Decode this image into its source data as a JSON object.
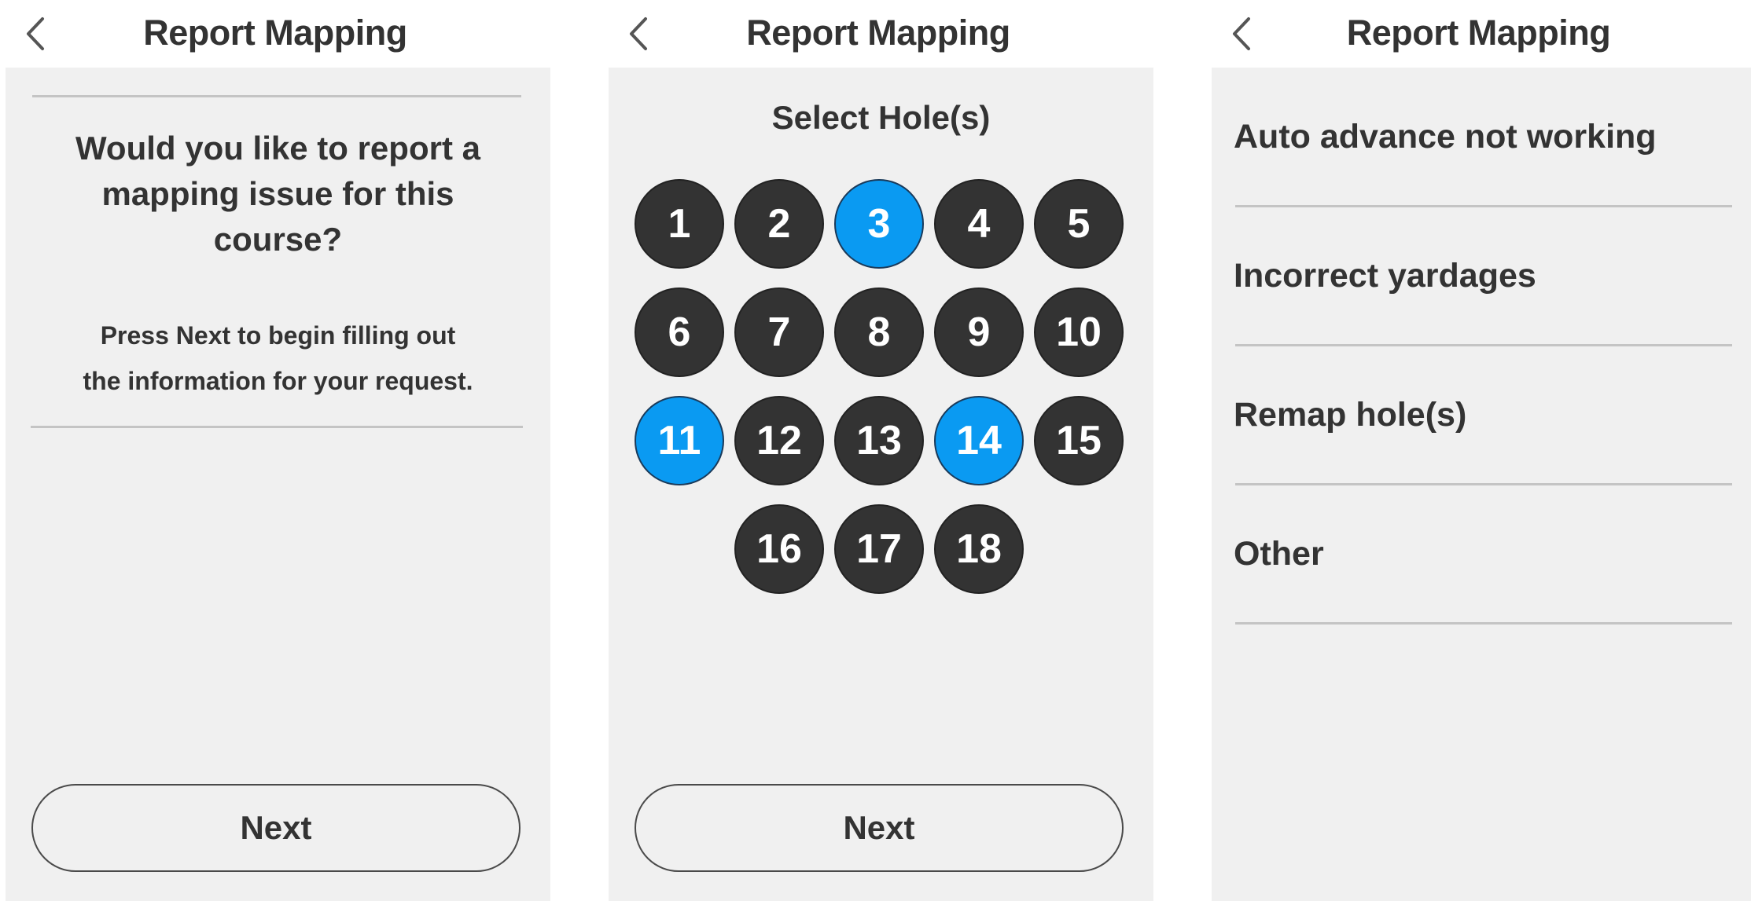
{
  "screens": [
    {
      "title": "Report Mapping",
      "question": "Would you like to report a mapping issue for this course?",
      "hint_line1": "Press Next to begin filling out",
      "hint_line2": "the information for your request.",
      "next_label": "Next"
    },
    {
      "title": "Report Mapping",
      "select_title": "Select Hole(s)",
      "holes": [
        {
          "number": "1",
          "selected": false
        },
        {
          "number": "2",
          "selected": false
        },
        {
          "number": "3",
          "selected": true
        },
        {
          "number": "4",
          "selected": false
        },
        {
          "number": "5",
          "selected": false
        },
        {
          "number": "6",
          "selected": false
        },
        {
          "number": "7",
          "selected": false
        },
        {
          "number": "8",
          "selected": false
        },
        {
          "number": "9",
          "selected": false
        },
        {
          "number": "10",
          "selected": false
        },
        {
          "number": "11",
          "selected": true
        },
        {
          "number": "12",
          "selected": false
        },
        {
          "number": "13",
          "selected": false
        },
        {
          "number": "14",
          "selected": true
        },
        {
          "number": "15",
          "selected": false
        },
        {
          "number": "16",
          "selected": false
        },
        {
          "number": "17",
          "selected": false
        },
        {
          "number": "18",
          "selected": false
        }
      ],
      "next_label": "Next"
    },
    {
      "title": "Report Mapping",
      "reasons": [
        "Auto advance not working",
        "Incorrect yardages",
        "Remap hole(s)",
        "Other"
      ]
    }
  ],
  "icons": {
    "back": "chevron-left-icon"
  },
  "colors": {
    "selected_hole": "#0a9af2",
    "unselected_hole": "#333333",
    "panel_background": "#f0f0f0",
    "text": "#333333"
  }
}
